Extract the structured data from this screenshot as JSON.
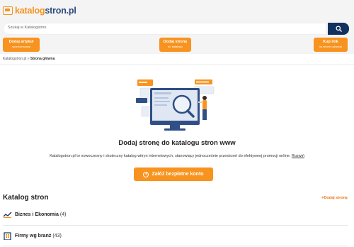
{
  "header": {
    "logo_part1": "katalog",
    "logo_part2": "stron.pl",
    "logo_icon": "folder-logo-icon"
  },
  "search": {
    "placeholder": "Szukaj w Katalogstron",
    "button_icon": "search-icon"
  },
  "actions": [
    {
      "title": "Dodaj artykuł",
      "subtitle": "sponsorowany"
    },
    {
      "title": "Dodaj stronę",
      "subtitle": "do katalogu"
    },
    {
      "title": "Kup link",
      "subtitle": "na stronie głównej"
    }
  ],
  "breadcrumb": {
    "root": "Katalogstron.pl",
    "separator": "»",
    "current": "Strona główna"
  },
  "hero": {
    "title": "Dodaj stronę do katalogu stron www",
    "description": "Katalogstron.pl to nowoczesny i skuteczny katalog witryn internetowych, stanowiący jednocześnie przestrzeń do efektywnej promocji online.",
    "more_link": "Rozwiń",
    "cta_label": "Załóż bezpłatne konto",
    "cta_icon": "plus-circle-icon"
  },
  "catalog": {
    "title": "Katalog stron",
    "add_label": "Dodaj stronę",
    "categories": [
      {
        "name": "Biznes i Ekonomia",
        "count": "(4)",
        "icon": "trend-chart-icon"
      },
      {
        "name": "Firmy wg branż",
        "count": "(43)",
        "icon": "building-icon"
      }
    ]
  },
  "colors": {
    "accent": "#f7931e",
    "navy": "#13315e",
    "background": "#f4f4f5"
  }
}
